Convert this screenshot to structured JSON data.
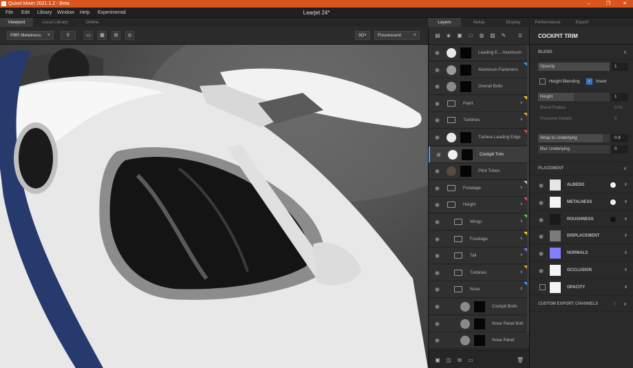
{
  "app": {
    "title": "Quixel Mixer 2021.1.2 - Beta",
    "document_title": "Learjet 24*"
  },
  "window_controls": {
    "minimize": "–",
    "maximize": "❐",
    "close": "✕"
  },
  "menu": [
    "File",
    "Edit",
    "Library",
    "Window",
    "Help",
    "Experimental"
  ],
  "left_tabs": [
    "Viewport",
    "Local Library",
    "Online"
  ],
  "viewport_toolbar": {
    "material_model": "PBR Metalness",
    "view_mode": "3D",
    "lighting": "Flourescent"
  },
  "right_tabs": [
    "Layers",
    "Setup",
    "Display",
    "Performance",
    "Export"
  ],
  "layers": [
    {
      "name": "Leading E... Aluminum",
      "type": "layer",
      "swatch": "#e8e8e8",
      "mask": true
    },
    {
      "name": "Aluminum Fasteners",
      "type": "layer",
      "swatch": "#9a9a9a",
      "mask": true,
      "tag": "#3aa0ff"
    },
    {
      "name": "Overall Bolts",
      "type": "layer",
      "swatch": "#8a8a8a",
      "mask": true
    },
    {
      "name": "Paint",
      "type": "folder",
      "chevron": "∨",
      "tag": "#f5d22a"
    },
    {
      "name": "Turbines",
      "type": "folder",
      "chevron": "∨",
      "tag": "#f5a623"
    },
    {
      "name": "Turbine Leading Edge",
      "type": "layer",
      "swatch": "#e8e8e8",
      "mask": true,
      "tag": "#e84b5a"
    },
    {
      "name": "Cockpit Trim",
      "type": "layer",
      "swatch": "#f0f0f0",
      "mask": true,
      "selected": true
    },
    {
      "name": "Pitot Tubes",
      "type": "layer",
      "swatch": "#5a4a40",
      "mask": true
    },
    {
      "name": "Fuselage",
      "type": "folder",
      "chevron": "∨",
      "tag": "#bdbdbd"
    },
    {
      "name": "Height",
      "type": "folder",
      "chevron": "∧",
      "tag": "#e84b5a"
    },
    {
      "name": "Wings",
      "type": "folder",
      "chevron": "∨",
      "indent": 1,
      "tag": "#48d45a"
    },
    {
      "name": "Fuselage",
      "type": "folder",
      "chevron": "∨",
      "indent": 1,
      "tag": "#f5d22a"
    },
    {
      "name": "Tail",
      "type": "folder",
      "chevron": "∨",
      "indent": 1,
      "tag": "#9b6cf0"
    },
    {
      "name": "Turbines",
      "type": "folder",
      "chevron": "∨",
      "indent": 1,
      "tag": "#f5a623"
    },
    {
      "name": "Nose",
      "type": "folder",
      "chevron": "∧",
      "indent": 1,
      "tag": "#3aa0ff"
    },
    {
      "name": "Cockpit Bolts",
      "type": "layer",
      "swatch": "#8a8a8a",
      "mask": true,
      "indent": 2
    },
    {
      "name": "Nose Panel Bolt",
      "type": "layer",
      "swatch": "#8a8a8a",
      "mask": true,
      "indent": 2
    },
    {
      "name": "Nose Panel",
      "type": "layer",
      "swatch": "#8a8a8a",
      "mask": true,
      "indent": 2
    }
  ],
  "properties": {
    "title": "COCKPIT TRIM",
    "blend_label": "BLEND",
    "opacity": {
      "label": "Opacity",
      "value": "1",
      "fill": 1.0
    },
    "height_blending": {
      "label": "Height Blending",
      "checked": false
    },
    "invert": {
      "label": "Invert",
      "checked": true
    },
    "height": {
      "label": "Height",
      "value": "1",
      "fill": 0.5
    },
    "blend_radius": {
      "label": "Blend Radius",
      "value": "0.01"
    },
    "preserve_details": {
      "label": "Preserve Details",
      "value": "0"
    },
    "wrap": {
      "label": "Wrap to Underlying",
      "value": "0.9",
      "fill": 0.9
    },
    "blur": {
      "label": "Blur Underlying",
      "value": "0",
      "fill": 0
    },
    "placement_label": "PLACEMENT",
    "channels": [
      {
        "name": "ALBEDO",
        "swatch": "#e6e6e6",
        "dot": "#f2f2f2"
      },
      {
        "name": "METALNESS",
        "swatch": "#f4f4f4",
        "dot": "#f2f2f2"
      },
      {
        "name": "ROUGHNESS",
        "swatch": "#1a1a1a",
        "dot": "#111111"
      },
      {
        "name": "DISPLACEMENT",
        "swatch": "#7a7a7a"
      },
      {
        "name": "NORMALS",
        "swatch": "#8080ff"
      },
      {
        "name": "OCCLUSION",
        "swatch": "#f4f4f4"
      },
      {
        "name": "OPACITY",
        "swatch": "#f4f4f4",
        "checkbox": true
      }
    ],
    "custom_export": "CUSTOM EXPORT CHANNELS"
  }
}
